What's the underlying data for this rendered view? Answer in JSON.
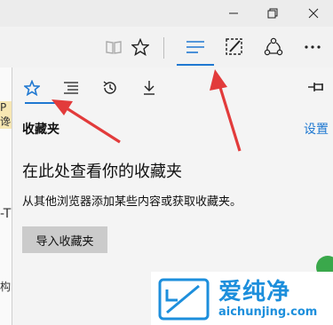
{
  "window_controls": {
    "minimize_icon": "minimize-icon",
    "restore_icon": "restore-icon",
    "close_icon": "close-icon"
  },
  "toolbar": {
    "icons": [
      "reading-view-icon",
      "star-icon",
      "hub-icon",
      "web-note-icon",
      "share-icon",
      "more-icon"
    ]
  },
  "side_strip": {
    "fragments": [
      "P谗",
      "-T",
      "构"
    ]
  },
  "hub_panel": {
    "tabs": [
      "favorites-tab",
      "reading-list-tab",
      "history-tab",
      "downloads-tab"
    ],
    "title": "收藏夹",
    "settings_link": "设置",
    "empty_heading": "在此处查看你的收藏夹",
    "empty_description": "从其他浏览器添加某些内容或获取收藏夹。",
    "import_button": "导入收藏夹"
  },
  "watermark": {
    "name": "爱纯净",
    "url": "aichunjing.com"
  },
  "colors": {
    "accent": "#1f78d1",
    "arrow": "#e23b3b",
    "watermark": "#1d8fdc"
  }
}
